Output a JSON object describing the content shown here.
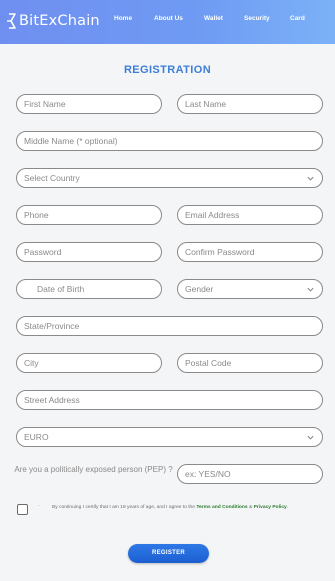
{
  "brand": {
    "name": "BitExChain"
  },
  "nav": {
    "items": [
      "Home",
      "About Us",
      "Wallet",
      "Security",
      "Card"
    ]
  },
  "form": {
    "title": "REGISTRATION",
    "first_name": "First Name",
    "last_name": "Last Name",
    "middle_name": "Middle Name (* optional)",
    "country": "Select Country",
    "phone": "Phone",
    "email": "Email Address",
    "password": "Password",
    "confirm_password": "Confirm Password",
    "dob": "Date of Birth",
    "gender": "Gender",
    "state": "State/Province",
    "city": "City",
    "postal": "Postal Code",
    "street": "Street Address",
    "currency": "EURO",
    "pep_label": "Are you a politically exposed person (PEP) ?",
    "pep_placeholder": "ex: YES/NO",
    "terms_bullet": "·",
    "terms_pre": "By continuing I certify that I am 18 years of age, and I agree to the ",
    "terms_link": "Terms and Conditions",
    "terms_mid": " & ",
    "privacy_link": "Privacy Policy",
    "terms_post": ".",
    "register_label": "REGISTER"
  },
  "colors": {
    "accent": "#3d7ed8",
    "button": "#1b5fd2",
    "link": "#2b7a2b"
  }
}
